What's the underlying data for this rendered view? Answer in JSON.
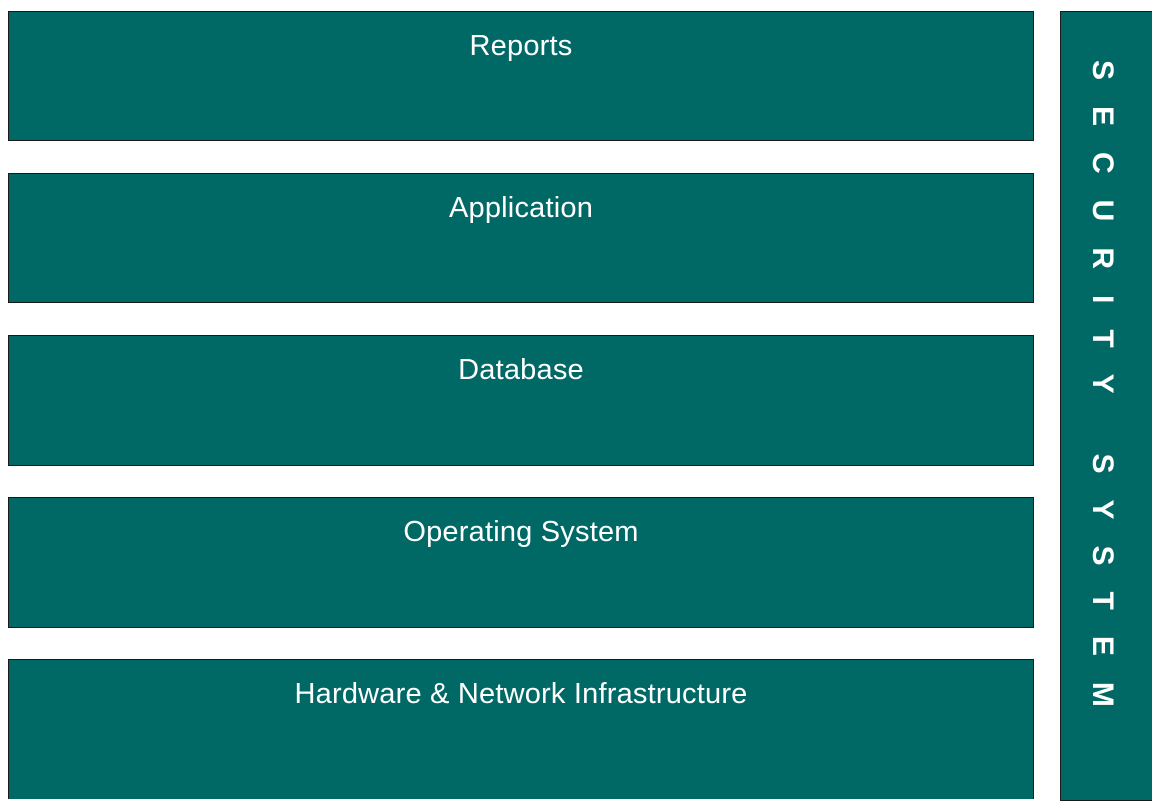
{
  "colors": {
    "box_fill": "#006966",
    "box_border": "#1a1a1a",
    "text": "#ffffff",
    "background": "#ffffff"
  },
  "layers": [
    {
      "label": "Reports"
    },
    {
      "label": "Application"
    },
    {
      "label": "Database"
    },
    {
      "label": "Operating System"
    },
    {
      "label": "Hardware & Network Infrastructure"
    }
  ],
  "side_panel": {
    "label": "SECURITY SYSTEM"
  }
}
